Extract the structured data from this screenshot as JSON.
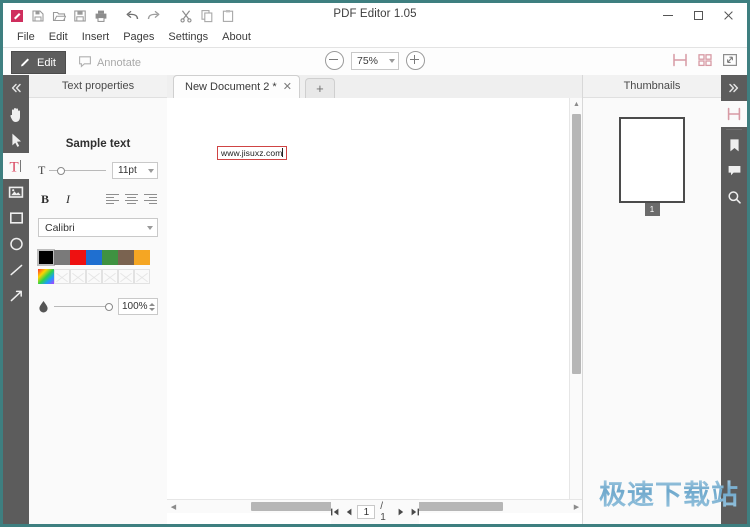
{
  "window": {
    "title": "PDF Editor 1.05",
    "minimize": "–",
    "maximize": "□",
    "close": "✕",
    "border_color": "#3e7f80"
  },
  "quick_toolbar": [
    {
      "name": "new-document-icon",
      "label": "New"
    },
    {
      "name": "save-as-icon",
      "label": "Save As"
    },
    {
      "name": "open-folder-icon",
      "label": "Open"
    },
    {
      "name": "save-icon",
      "label": "Save"
    },
    {
      "name": "print-icon",
      "label": "Print"
    },
    {
      "name": "undo-icon",
      "label": "Undo"
    },
    {
      "name": "redo-icon",
      "label": "Redo"
    },
    {
      "name": "cut-icon",
      "label": "Cut"
    },
    {
      "name": "copy-icon",
      "label": "Copy"
    },
    {
      "name": "paste-icon",
      "label": "Paste"
    }
  ],
  "menu": {
    "items": [
      {
        "label": "File"
      },
      {
        "label": "Edit"
      },
      {
        "label": "Insert"
      },
      {
        "label": "Pages"
      },
      {
        "label": "Settings"
      },
      {
        "label": "About"
      }
    ]
  },
  "modebar": {
    "edit_label": "Edit",
    "annotate_label": "Annotate",
    "zoom_value": "75%",
    "zoom_out": "−",
    "zoom_in": "+",
    "view_modes": [
      {
        "name": "split-view-icon"
      },
      {
        "name": "grid-view-icon"
      },
      {
        "name": "fit-screen-icon"
      }
    ],
    "accent_color": "#d79aa4"
  },
  "left_rail": {
    "items": [
      {
        "name": "collapse-panel-icon",
        "label": "Collapse"
      },
      {
        "name": "hand-tool-icon",
        "label": "Hand"
      },
      {
        "name": "select-tool-icon",
        "label": "Select"
      },
      {
        "name": "text-tool-icon",
        "label": "Text",
        "active": true
      },
      {
        "name": "image-tool-icon",
        "label": "Image"
      },
      {
        "name": "rectangle-tool-icon",
        "label": "Rectangle"
      },
      {
        "name": "ellipse-tool-icon",
        "label": "Ellipse"
      },
      {
        "name": "line-tool-icon",
        "label": "Line"
      },
      {
        "name": "arrow-tool-icon",
        "label": "Arrow"
      }
    ]
  },
  "text_properties": {
    "title": "Text properties",
    "sample_text": "Sample text",
    "font_size": "11pt",
    "bold_label": "B",
    "italic_label": "I",
    "font_family": "Calibri",
    "opacity": "100%",
    "swatches": [
      "#000000",
      "#7a7a7a",
      "#ee1111",
      "#1f6fd0",
      "#3f9241",
      "#7a6350",
      "#f5a623"
    ],
    "selected_swatch": "#000000",
    "custom_color_label": "Custom color"
  },
  "document": {
    "tab_label": "New Document 2 *",
    "tab_close": "✕",
    "tab_add": "+",
    "textbox_value": "www.jisuxz.com",
    "textbox_border_color": "#cf4444"
  },
  "thumbnails": {
    "title": "Thumbnails",
    "pages": [
      {
        "number": "1"
      }
    ]
  },
  "right_rail": {
    "items": [
      {
        "name": "expand-panel-icon",
        "label": "Expand"
      },
      {
        "name": "pages-panel-icon",
        "label": "Pages",
        "active": true
      },
      {
        "name": "bookmarks-panel-icon",
        "label": "Bookmarks"
      },
      {
        "name": "comments-panel-icon",
        "label": "Comments"
      },
      {
        "name": "search-panel-icon",
        "label": "Search"
      }
    ]
  },
  "statusbar": {
    "first_page": "⧏|",
    "prev_page": "◀",
    "current_page": "1",
    "total_pages": "/ 1",
    "next_page": "▶",
    "last_page": "|⧐"
  },
  "watermark": {
    "text": "极速下载站"
  }
}
